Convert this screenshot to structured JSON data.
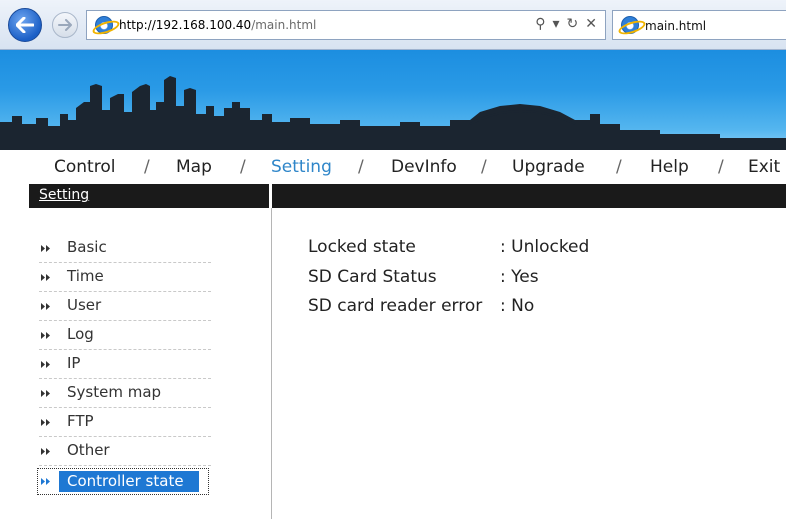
{
  "browser": {
    "url_host": "http://192.168.100.40",
    "url_path": "/main.html",
    "tab_title": "main.html",
    "icons": {
      "back": "back-arrow-icon",
      "forward": "forward-arrow-icon",
      "page": "ie-page-icon",
      "search": "search-icon",
      "dropdown": "dropdown-arrow-icon",
      "refresh": "refresh-icon",
      "stop": "stop-icon"
    },
    "glyphs": {
      "search": "⚲",
      "dropdown": "▾",
      "refresh": "↻",
      "stop": "✕"
    }
  },
  "topnav": {
    "items": [
      "Control",
      "Map",
      "Setting",
      "DevInfo",
      "Upgrade",
      "Help",
      "Exit"
    ],
    "separator": "/",
    "active": "Setting",
    "active_color": "#2f86c9"
  },
  "section": {
    "title": "Setting"
  },
  "sidebar": {
    "items": [
      {
        "label": "Basic"
      },
      {
        "label": "Time"
      },
      {
        "label": "User"
      },
      {
        "label": "Log"
      },
      {
        "label": "IP"
      },
      {
        "label": "System map"
      },
      {
        "label": "FTP"
      },
      {
        "label": "Other"
      },
      {
        "label": "Controller state"
      }
    ],
    "selected": "Controller state",
    "selected_color": "#1e78d3"
  },
  "status": {
    "rows": [
      {
        "key": "Locked state",
        "value": ": Unlocked"
      },
      {
        "key": "SD Card Status",
        "value": ": Yes"
      },
      {
        "key": "SD card reader error",
        "value": ": No"
      }
    ]
  }
}
